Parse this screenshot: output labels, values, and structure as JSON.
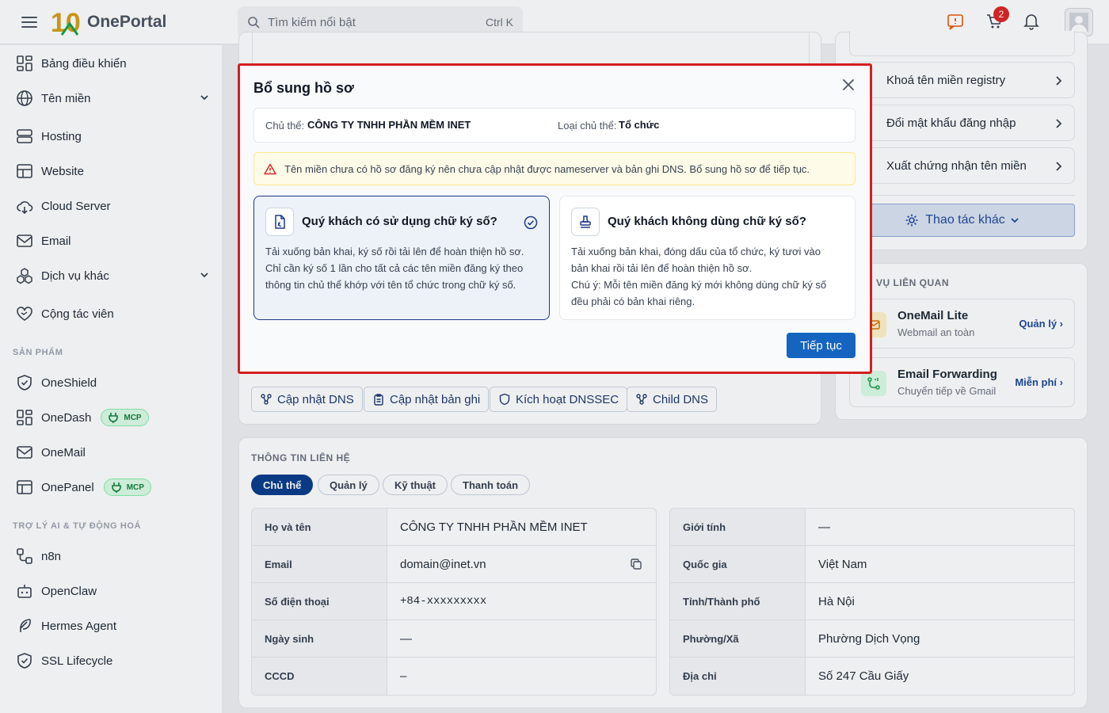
{
  "topbar": {
    "brand_mark": "10",
    "brand_name": "OnePortal",
    "search_placeholder": "Tìm kiếm nổi bật",
    "search_shortcut": "Ctrl K",
    "cart_count": "2"
  },
  "sidebar": {
    "items": [
      "Bảng điều khiển",
      "Tên miền",
      "Hosting",
      "Website",
      "Cloud Server",
      "Email",
      "Dịch vụ khác",
      "Cộng tác viên"
    ],
    "section_products": "SẢN PHẨM",
    "products": [
      "OneShield",
      "OneDash",
      "OneMail",
      "OnePanel"
    ],
    "mcp_label": "MCP",
    "section_ai": "TRỢ LÝ AI & TỰ ĐỘNG HOÁ",
    "ai_items": [
      "n8n",
      "OpenClaw",
      "Hermes Agent",
      "SSL Lifecycle"
    ]
  },
  "dns_buttons": [
    "Cập nhật DNS",
    "Cập nhật bản ghi",
    "Kích hoạt DNSSEC",
    "Child DNS"
  ],
  "actions": {
    "items": [
      "Khoá tên miền registry",
      "Đổi mật khẩu đăng nhập",
      "Xuất chứng nhận tên miền"
    ],
    "other_label": "Thao tác khác"
  },
  "related": {
    "title": "VỤ LIÊN QUAN",
    "items": [
      {
        "name": "OneMail Lite",
        "desc": "Webmail an toàn",
        "link": "Quản lý ›"
      },
      {
        "name": "Email Forwarding",
        "desc": "Chuyển tiếp về Gmail",
        "link": "Miễn phí ›"
      }
    ]
  },
  "contact": {
    "title": "THÔNG TIN LIÊN HỆ",
    "tabs": [
      "Chủ thể",
      "Quản lý",
      "Kỹ thuật",
      "Thanh toán"
    ],
    "left": [
      {
        "k": "Họ và tên",
        "v": "CÔNG TY TNHH PHẦN MỀM INET"
      },
      {
        "k": "Email",
        "v": "domain@inet.vn"
      },
      {
        "k": "Số điện thoại",
        "v": "+84-xxxxxxxxx"
      },
      {
        "k": "Ngày sinh",
        "v": "—"
      },
      {
        "k": "CCCD",
        "v": "–"
      }
    ],
    "right": [
      {
        "k": "Giới tính",
        "v": "—"
      },
      {
        "k": "Quốc gia",
        "v": "Việt Nam"
      },
      {
        "k": "Tỉnh/Thành phố",
        "v": "Hà Nội"
      },
      {
        "k": "Phường/Xã",
        "v": "Phường Dịch Vọng"
      },
      {
        "k": "Địa chỉ",
        "v": "Số 247 Cầu Giấy"
      }
    ]
  },
  "modal": {
    "title": "Bổ sung hồ sơ",
    "owner_label": "Chủ thể:",
    "owner_value": "CÔNG TY TNHH PHẦN MỀM INET",
    "type_label": "Loại chủ thể:",
    "type_value": "Tổ chức",
    "warning": "Tên miền chưa có hồ sơ đăng ký nên chưa cập nhật được nameserver và bản ghi DNS. Bổ sung hồ sơ để tiếp tục.",
    "option1": {
      "title": "Quý khách có sử dụng chữ ký số?",
      "desc": "Tải xuống bản khai, ký số rồi tải lên để hoàn thiện hồ sơ. Chỉ cần ký số 1 lần cho tất cả các tên miền đăng ký theo thông tin chủ thể khớp với tên tổ chức trong chữ ký số."
    },
    "option2": {
      "title": "Quý khách không dùng chữ ký số?",
      "desc1": "Tải xuống bản khai, đóng dấu của tổ chức, ký tươi vào bản khai rồi tải lên để hoàn thiện hồ sơ.",
      "desc2": "Chú ý: Mỗi tên miền đăng ký mới không dùng chữ ký số đều phải có bản khai riêng."
    },
    "continue": "Tiếp tục"
  },
  "colors": {
    "brand": "#0b3d8c",
    "accent": "#1565c0",
    "highlight": "#d41f1f",
    "mcp": "#15803d"
  }
}
